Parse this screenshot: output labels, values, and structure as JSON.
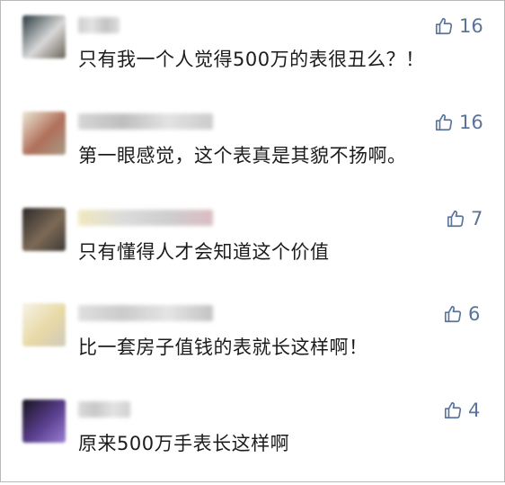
{
  "comments": [
    {
      "text": "只有我一个人觉得500万的表很丑么？！",
      "likes": "16",
      "name_blur_colors": [
        "#c9c9c9",
        "#e1e1e1",
        "#bdbdbd",
        "#dadada"
      ],
      "avatar_colors": [
        "#2b3a40",
        "#d9d9d9",
        "#6a6256"
      ]
    },
    {
      "text": "第一眼感觉，这个表真是其貌不扬啊。",
      "likes": "16",
      "name_blur_colors": [
        "#d2d2d2",
        "#b8b8b8",
        "#e0e0e0",
        "#c6c6c6"
      ],
      "avatar_colors": [
        "#ece7d6",
        "#b0705a",
        "#a89a86"
      ]
    },
    {
      "text": "只有懂得人才会知道这个价值",
      "likes": "7",
      "name_blur_colors": [
        "#f0e6b8",
        "#d8d8d8",
        "#c9c9c9",
        "#d7b6bd"
      ],
      "avatar_colors": [
        "#2d2a2a",
        "#7c6a55",
        "#3e3a36"
      ]
    },
    {
      "text": "比一套房子值钱的表就长这样啊！",
      "likes": "6",
      "name_blur_colors": [
        "#dcdcdc",
        "#c6c6c6",
        "#e2e2e2",
        "#bdbdbd"
      ],
      "avatar_colors": [
        "#f7f2e6",
        "#e7d9a6",
        "#cfc9bb"
      ]
    },
    {
      "text": "原来500万手表长这样啊",
      "likes": "4",
      "name_blur_colors": [
        "#d6d6d6",
        "#c3c3c3",
        "#e0e0e0",
        "#cccccc"
      ],
      "avatar_colors": [
        "#17131e",
        "#5b3f8f",
        "#9a7fd1"
      ]
    }
  ],
  "like_icon": "thumbs-up-icon",
  "colors": {
    "text": "#1c1c1c",
    "like": "#5a7399",
    "border": "#b9b9b9"
  }
}
